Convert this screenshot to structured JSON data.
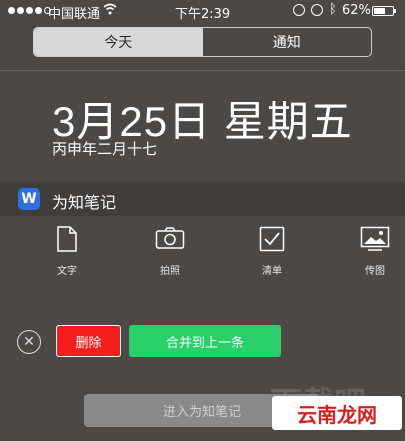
{
  "status_bar": {
    "carrier": "中国联通",
    "time": "下午2:39",
    "battery_percent": "62%",
    "battery_level": 0.62,
    "signal_bars_filled": 4,
    "signal_bars_total": 5
  },
  "segments": [
    {
      "label": "今天",
      "active": true
    },
    {
      "label": "通知",
      "active": false
    }
  ],
  "date": {
    "main": "3月25日 星期五",
    "lunar": "丙申年二月十七"
  },
  "widget": {
    "icon_letter": "W",
    "icon_color": "#2f6fe0",
    "name": "为知笔记",
    "actions": [
      {
        "label": "文字",
        "icon": "document-icon"
      },
      {
        "label": "拍照",
        "icon": "camera-icon"
      },
      {
        "label": "清单",
        "icon": "checkbox-icon"
      },
      {
        "label": "传图",
        "icon": "image-icon"
      }
    ],
    "delete_label": "删除",
    "merge_label": "合并到上一条",
    "enter_label": "进入为知笔记"
  },
  "watermark": {
    "back_text": "下载吧",
    "front_text": "云南龙网"
  },
  "colors": {
    "delete": "#f41e1e",
    "merge": "#29d068"
  }
}
